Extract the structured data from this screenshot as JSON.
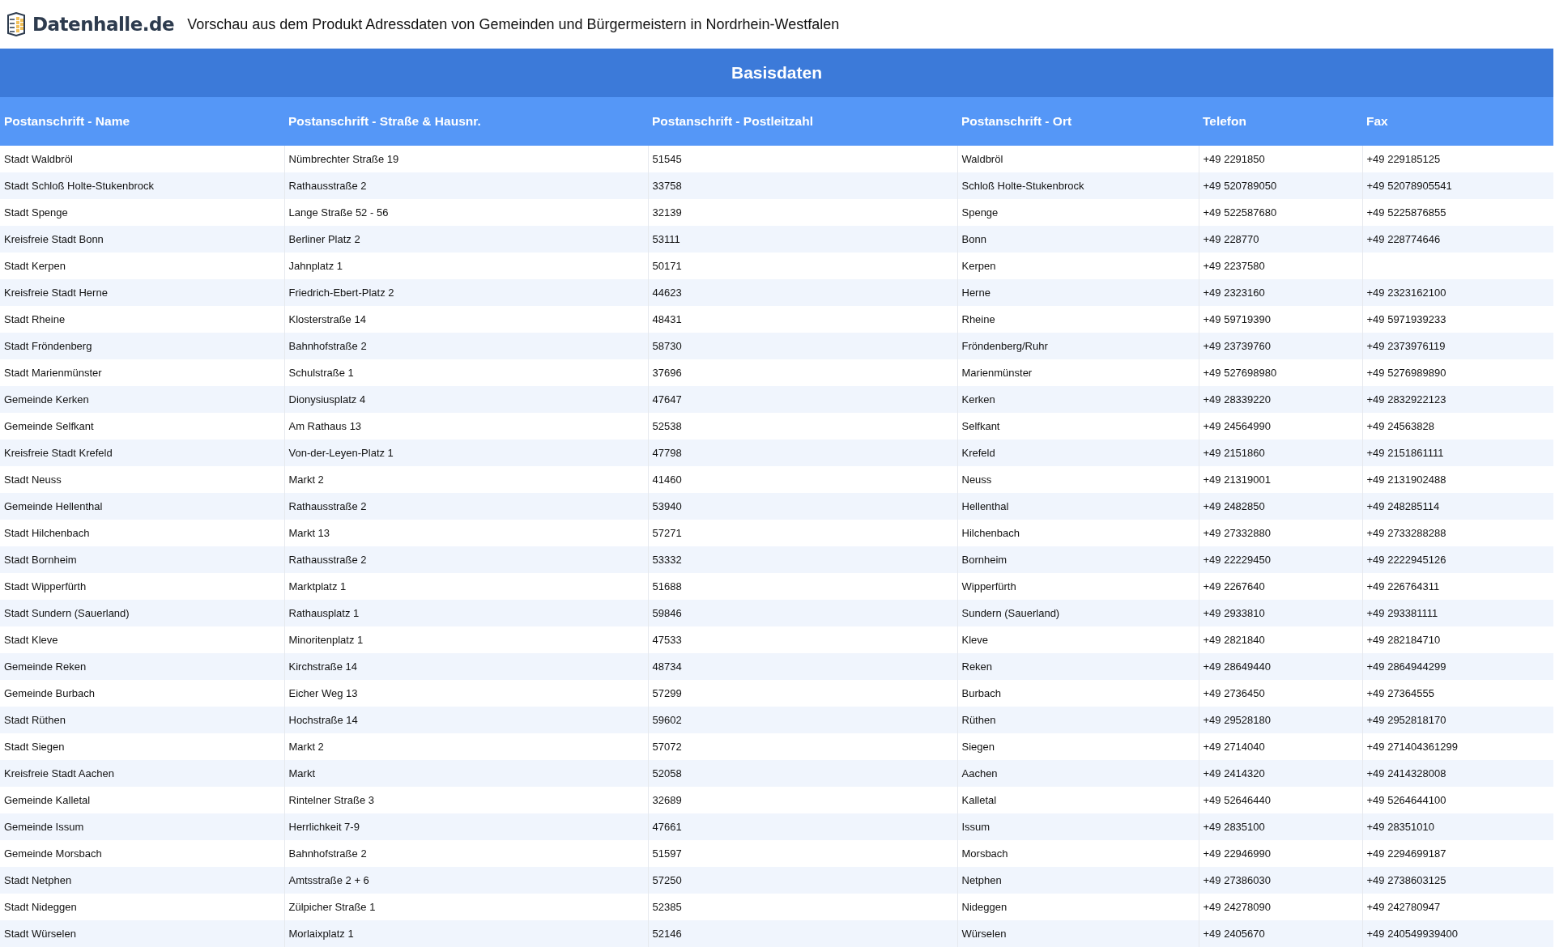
{
  "header": {
    "logo_text": "Datenhalle.de",
    "title": "Vorschau aus dem Produkt Adressdaten von Gemeinden und Bürgermeistern in Nordrhein-Westfalen"
  },
  "table": {
    "caption": "Basisdaten",
    "columns": [
      "Postanschrift - Name",
      "Postanschrift - Straße & Hausnr.",
      "Postanschrift - Postleitzahl",
      "Postanschrift - Ort",
      "Telefon",
      "Fax"
    ],
    "rows": [
      [
        "Stadt Waldbröl",
        "Nümbrechter Straße 19",
        "51545",
        "Waldbröl",
        "+49 2291850",
        "+49 229185125"
      ],
      [
        "Stadt Schloß Holte-Stukenbrock",
        "Rathausstraße 2",
        "33758",
        "Schloß Holte-Stukenbrock",
        "+49 520789050",
        "+49 52078905541"
      ],
      [
        "Stadt Spenge",
        "Lange Straße 52 - 56",
        "32139",
        "Spenge",
        "+49 522587680",
        "+49 5225876855"
      ],
      [
        "Kreisfreie Stadt Bonn",
        "Berliner Platz 2",
        "53111",
        "Bonn",
        "+49 228770",
        "+49 228774646"
      ],
      [
        "Stadt Kerpen",
        "Jahnplatz 1",
        "50171",
        "Kerpen",
        "+49 2237580",
        null
      ],
      [
        "Kreisfreie Stadt Herne",
        "Friedrich-Ebert-Platz 2",
        "44623",
        "Herne",
        "+49 2323160",
        "+49 2323162100"
      ],
      [
        "Stadt Rheine",
        "Klosterstraße 14",
        "48431",
        "Rheine",
        "+49 59719390",
        "+49 5971939233"
      ],
      [
        "Stadt Fröndenberg",
        "Bahnhofstraße 2",
        "58730",
        "Fröndenberg/Ruhr",
        "+49 23739760",
        "+49 2373976119"
      ],
      [
        "Stadt Marienmünster",
        "Schulstraße 1",
        "37696",
        "Marienmünster",
        "+49 527698980",
        "+49 5276989890"
      ],
      [
        "Gemeinde Kerken",
        "Dionysiusplatz 4",
        "47647",
        "Kerken",
        "+49 28339220",
        "+49 2832922123"
      ],
      [
        "Gemeinde Selfkant",
        "Am Rathaus 13",
        "52538",
        "Selfkant",
        "+49 24564990",
        "+49 24563828"
      ],
      [
        "Kreisfreie Stadt Krefeld",
        "Von-der-Leyen-Platz 1",
        "47798",
        "Krefeld",
        "+49 2151860",
        "+49 2151861111"
      ],
      [
        "Stadt Neuss",
        "Markt 2",
        "41460",
        "Neuss",
        "+49 21319001",
        "+49 2131902488"
      ],
      [
        "Gemeinde Hellenthal",
        "Rathausstraße 2",
        "53940",
        "Hellenthal",
        "+49 2482850",
        "+49 248285114"
      ],
      [
        "Stadt Hilchenbach",
        "Markt 13",
        "57271",
        "Hilchenbach",
        "+49 27332880",
        "+49 2733288288"
      ],
      [
        "Stadt Bornheim",
        "Rathausstraße 2",
        "53332",
        "Bornheim",
        "+49 22229450",
        "+49 2222945126"
      ],
      [
        "Stadt Wipperfürth",
        "Marktplatz 1",
        "51688",
        "Wipperfürth",
        "+49 2267640",
        "+49 226764311"
      ],
      [
        "Stadt Sundern (Sauerland)",
        "Rathausplatz 1",
        "59846",
        "Sundern (Sauerland)",
        "+49 2933810",
        "+49 293381111"
      ],
      [
        "Stadt Kleve",
        "Minoritenplatz 1",
        "47533",
        "Kleve",
        "+49 2821840",
        "+49 282184710"
      ],
      [
        "Gemeinde Reken",
        "Kirchstraße 14",
        "48734",
        "Reken",
        "+49 28649440",
        "+49 2864944299"
      ],
      [
        "Gemeinde Burbach",
        "Eicher Weg 13",
        "57299",
        "Burbach",
        "+49 2736450",
        "+49 27364555"
      ],
      [
        "Stadt Rüthen",
        "Hochstraße 14",
        "59602",
        "Rüthen",
        "+49 29528180",
        "+49 2952818170"
      ],
      [
        "Stadt Siegen",
        "Markt 2",
        "57072",
        "Siegen",
        "+49 2714040",
        "+49 271404361299"
      ],
      [
        "Kreisfreie Stadt Aachen",
        "Markt",
        "52058",
        "Aachen",
        "+49 2414320",
        "+49 2414328008"
      ],
      [
        "Gemeinde Kalletal",
        "Rintelner Straße 3",
        "32689",
        "Kalletal",
        "+49 52646440",
        "+49 5264644100"
      ],
      [
        "Gemeinde Issum",
        "Herrlichkeit 7-9",
        "47661",
        "Issum",
        "+49 2835100",
        "+49 28351010"
      ],
      [
        "Gemeinde Morsbach",
        "Bahnhofstraße 2",
        "51597",
        "Morsbach",
        "+49 22946990",
        "+49 2294699187"
      ],
      [
        "Stadt Netphen",
        "Amtsstraße 2 + 6",
        "57250",
        "Netphen",
        "+49 27386030",
        "+49 2738603125"
      ],
      [
        "Stadt Nideggen",
        "Zülpicher Straße 1",
        "52385",
        "Nideggen",
        "+49 24278090",
        "+49 242780947"
      ],
      [
        "Stadt Würselen",
        "Morlaixplatz 1",
        "52146",
        "Würselen",
        "+49 2405670",
        "+49 240549939400"
      ]
    ]
  }
}
